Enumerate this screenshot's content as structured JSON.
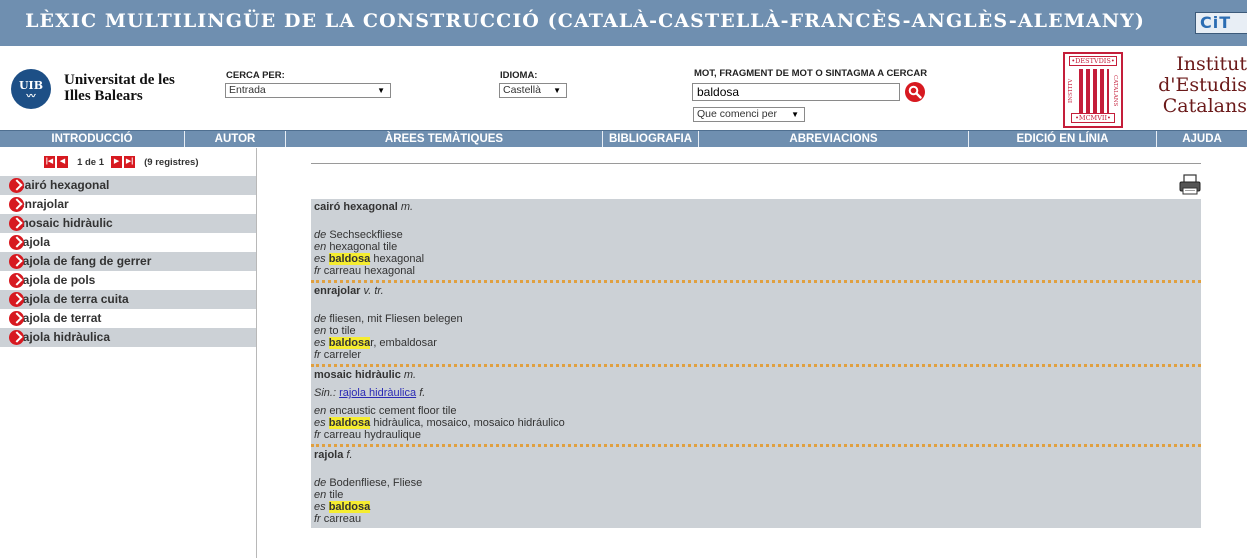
{
  "banner": {
    "title": "LÈXIC MULTILINGÜE DE LA CONSTRUCCIÓ (CATALÀ-CASTELLÀ-FRANCÈS-ANGLÈS-ALEMANY)",
    "cit_logo": "CiT"
  },
  "header": {
    "uib_logo_text": "UIB",
    "uib_name_line1": "Universitat de les",
    "uib_name_line2": "Illes Balears",
    "cerca_per_label": "CERCA PER:",
    "cerca_per_value": "Entrada",
    "idioma_label": "IDIOMA:",
    "idioma_value": "Castellà",
    "mot_label": "MOT, FRAGMENT DE MOT O SINTAGMA A CERCAR",
    "search_value": "baldosa",
    "mode_value": "Que comenci per",
    "iec_seal_top": "•DESTVDIS•",
    "iec_seal_left": "INSTITV",
    "iec_seal_right": "CATALANS",
    "iec_seal_bottom": "•MCMVII•",
    "iec_name_line1": "Institut",
    "iec_name_line2": "d'Estudis",
    "iec_name_line3": "Catalans"
  },
  "nav": {
    "items": [
      "INTRODUCCIÓ",
      "AUTOR",
      "ÀREES TEMÀTIQUES",
      "BIBLIOGRAFIA",
      "ABREVIACIONS",
      "EDICIÓ EN LÍNIA",
      "AJUDA"
    ]
  },
  "pager": {
    "page_text": "1 de 1",
    "records_text": "(9 registres)"
  },
  "results": [
    "cairó hexagonal",
    "enrajolar",
    "mosaic hidràulic",
    "rajola",
    "rajola de fang de gerrer",
    "rajola de pols",
    "rajola de terra cuita",
    "rajola de terrat",
    "rajola hidràulica"
  ],
  "entries": [
    {
      "term": "cairó hexagonal",
      "gram": "m.",
      "de": "Sechseckfliese",
      "en": "hexagonal tile",
      "es_hl": "baldosa",
      "es_rest": " hexagonal",
      "fr": "carreau hexagonal"
    },
    {
      "term": "enrajolar",
      "gram": "v. tr.",
      "de": "fliesen, mit Fliesen belegen",
      "en": "to tile",
      "es_hl": "baldosa",
      "es_rest": "r, embaldosar",
      "fr": "carreler"
    },
    {
      "term": "mosaic hidràulic",
      "gram": "m.",
      "sin_label": "Sin.:",
      "sin_link": "rajola hidràulica",
      "sin_gram": "f.",
      "en": "encaustic cement floor tile",
      "es_hl": "baldosa",
      "es_rest": " hidràulica, mosaico, mosaico hidráulico",
      "fr": "carreau hydraulique"
    },
    {
      "term": "rajola",
      "gram": "f.",
      "de": "Bodenfliese, Fliese",
      "en": "tile",
      "es_hl": "baldosa",
      "es_rest": "",
      "fr": "carreau"
    }
  ],
  "lang_codes": {
    "de": "de",
    "en": "en",
    "es": "es",
    "fr": "fr"
  },
  "colors": {
    "banner": "#6f8fb0",
    "accent_red": "#d71920",
    "row_grey": "#ccd1d6",
    "highlight": "#f5ec30"
  }
}
